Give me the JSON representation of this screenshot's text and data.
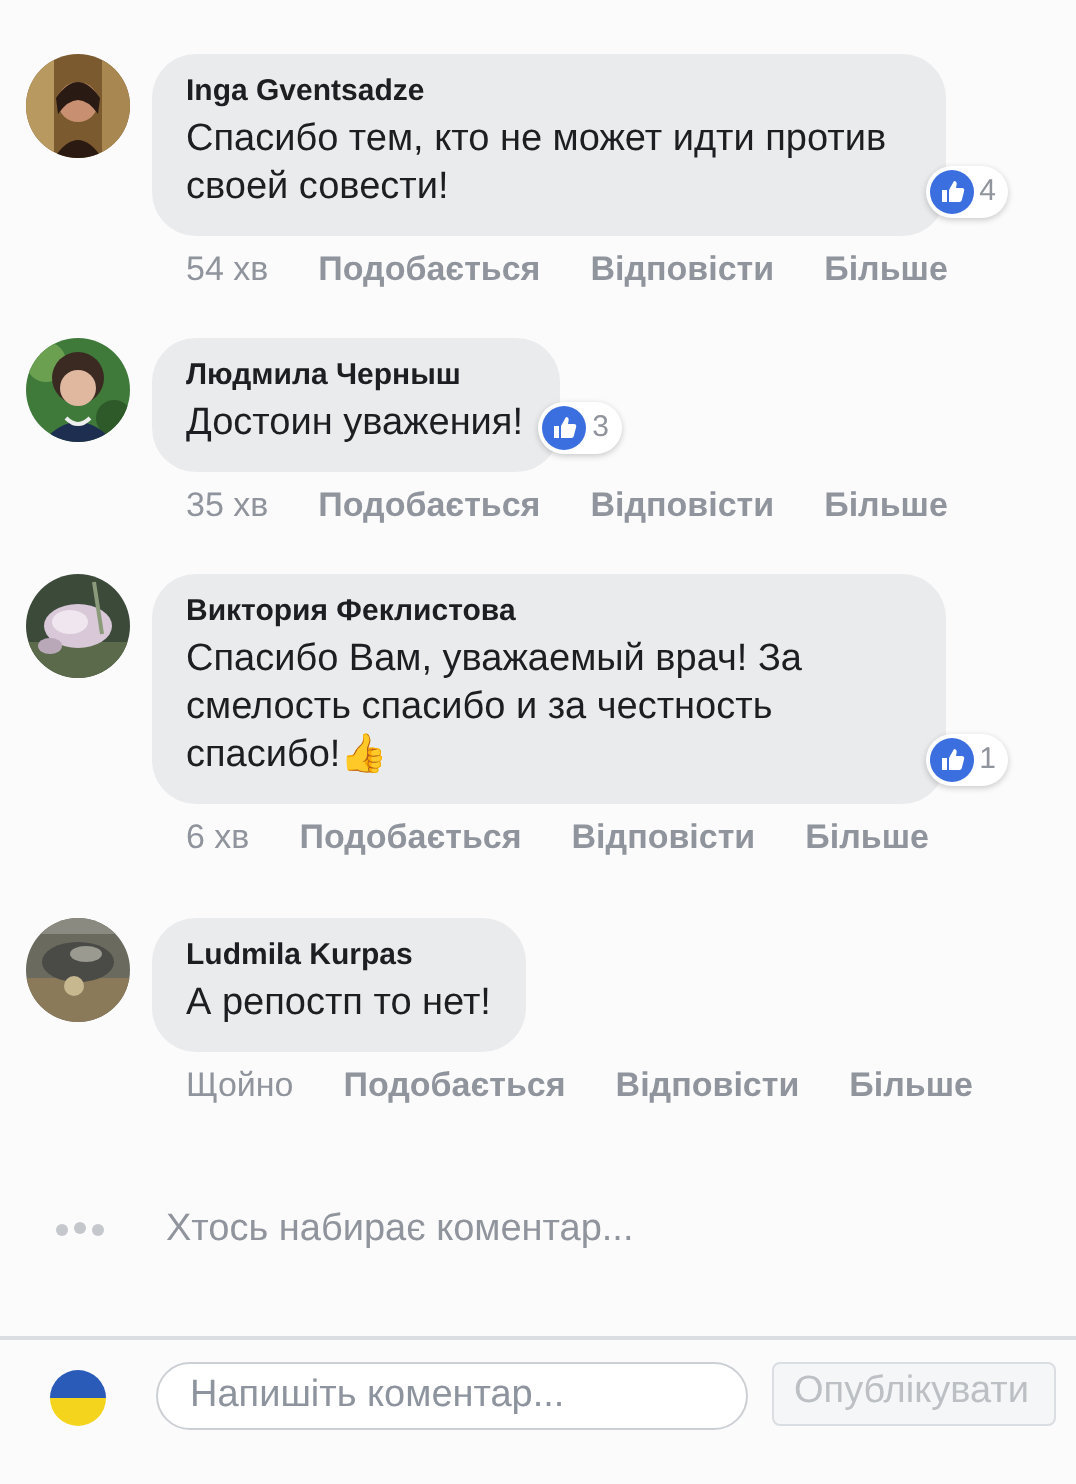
{
  "comments": [
    {
      "author": "Inga Gventsadze",
      "text": "Спасибо тем, кто не может идти против своей совести!",
      "reactions": "4",
      "time": "54 хв",
      "actions": [
        "Подобається",
        "Відповісти",
        "Більше"
      ]
    },
    {
      "author": "Людмила Черныш",
      "text": "Достоин уважения!",
      "reactions": "3",
      "time": "35 хв",
      "actions": [
        "Подобається",
        "Відповісти",
        "Більше"
      ]
    },
    {
      "author": "Виктория Феклистова",
      "text": "Спасибо Вам, уважаемый врач! За смелость спасибо и за честность спасибо!👍",
      "reactions": "1",
      "time": "6 хв",
      "actions": [
        "Подобається",
        "Відповісти",
        "Більше"
      ]
    },
    {
      "author": "Ludmila Kurpas",
      "text": "А репостп то нет!",
      "time": "Щойно",
      "actions": [
        "Подобається",
        "Відповісти",
        "Більше"
      ]
    }
  ],
  "typing": {
    "text": "Хтось набирає коментар..."
  },
  "composer": {
    "placeholder": "Напишіть коментар...",
    "button": "Опублікувати"
  }
}
